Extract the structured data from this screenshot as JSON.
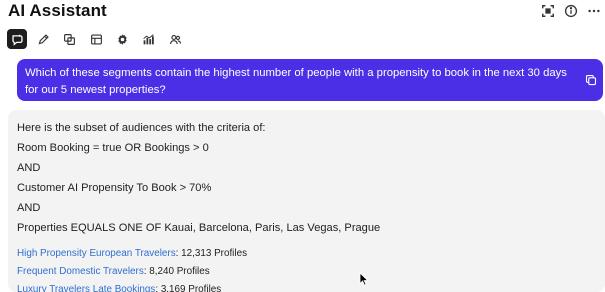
{
  "header": {
    "title": "AI Assistant",
    "icons": [
      "expand-icon",
      "info-icon",
      "more-icon"
    ]
  },
  "toolbar": {
    "tools": [
      "ai-chat-icon",
      "pencil-icon",
      "copy-layers-icon",
      "dataset-icon",
      "settings-gear-icon",
      "chart-icon",
      "audience-icon"
    ],
    "active": "ai-chat-icon"
  },
  "user_message": {
    "text": "Which of these segments contain the highest number of people with a propensity to book in the next 30 days for our 5 newest properties?"
  },
  "reply": {
    "lines": [
      "Here is the subset of audiences with the criteria of:",
      "Room Booking = true OR Bookings > 0",
      "AND",
      "Customer AI Propensity To Book > 70%",
      "AND",
      "Properties EQUALS ONE OF Kauai, Barcelona, Paris, Las Vegas, Prague"
    ],
    "results": [
      {
        "name": "High Propensity European Travelers",
        "count": ": 12,313 Profiles"
      },
      {
        "name": "Frequent Domestic Travelers",
        "count": ": 8,240 Profiles"
      },
      {
        "name": "Luxury Travelers Late Bookings",
        "count": ": 3,169 Profiles"
      }
    ]
  },
  "colors": {
    "user_bubble": "#4b2fe6",
    "reply_bg": "#f3f3f3",
    "link": "#2f6fd0"
  }
}
